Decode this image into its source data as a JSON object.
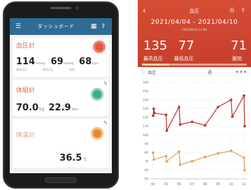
{
  "dashboard": {
    "title": "ダッシュボード",
    "blood_pressure": {
      "label": "血圧計",
      "systolic": "114",
      "systolic_unit": "mmHg",
      "diastolic": "69",
      "diastolic_unit": "mmHg",
      "pulse": "68",
      "pulse_unit": "bpm",
      "sublabels": [
        "最高血圧",
        "最低血圧",
        "脈拍"
      ],
      "badge_color": "#e9543c"
    },
    "body_composition": {
      "label": "体組計",
      "weight": "70.0",
      "weight_unit": "kg",
      "bmi": "22.9",
      "bmi_unit": "bmi",
      "badge_color": "#3daa8a"
    },
    "thermometer": {
      "label": "体温計",
      "temperature": "36.5",
      "temperature_unit": "℃",
      "badge_color": "#e8892e"
    }
  },
  "detail": {
    "title": "血圧",
    "date_range": "2021/04/04 - 2021/04/10",
    "sub_range": "2021/04/10 12:00",
    "systolic": "135",
    "systolic_label": "最高血圧",
    "diastolic": "77",
    "diastolic_label": "最低血圧",
    "pulse": "71",
    "pulse_label": "脈拍",
    "control_label": "血圧",
    "period_label": "週",
    "progress": 0.26,
    "accent": "#d54d35"
  },
  "chart_data": {
    "type": "line",
    "x_ticks": [
      "04",
      "05",
      "06",
      "07",
      "08",
      "09",
      "10",
      "11"
    ],
    "y_ticks": [
      "160",
      "150",
      "140",
      "130",
      "120",
      "110",
      "100",
      "90",
      "80",
      "70",
      "60",
      "50"
    ],
    "ylim": [
      50,
      160
    ],
    "series": [
      {
        "color": "#b8352b",
        "x": [
          0,
          0.05,
          0.1,
          1,
          1.05,
          2,
          2.08,
          3,
          4,
          5,
          6,
          6.1,
          7,
          7.05
        ],
        "values": [
          122,
          130,
          125,
          123,
          105,
          132,
          112,
          115,
          111,
          132,
          140,
          121,
          145,
          110
        ]
      },
      {
        "color": "#e0a060",
        "x": [
          0,
          0.05,
          1,
          1.05,
          2,
          2.08,
          3,
          4,
          5,
          6,
          7,
          7.05
        ],
        "values": [
          80,
          72,
          76,
          70,
          81,
          66,
          70,
          75,
          79,
          82,
          74,
          60
        ]
      }
    ]
  }
}
